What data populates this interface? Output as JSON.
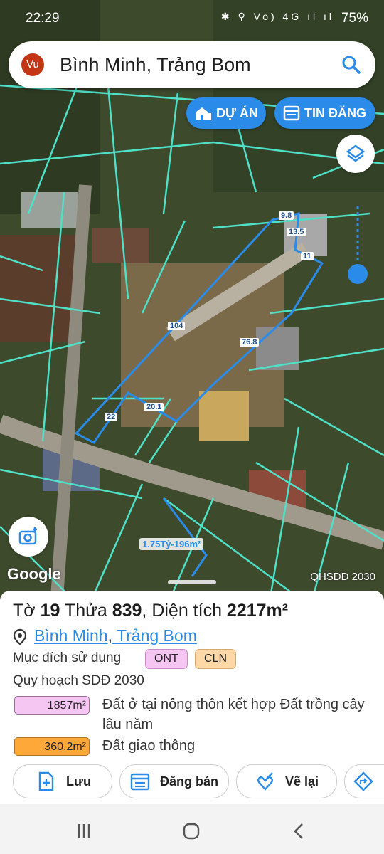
{
  "status": {
    "time": "22:29",
    "icons": "✱ ⚲ Vo) 4G ıl ıl",
    "battery": "75%"
  },
  "search": {
    "avatar": "Vu",
    "query": "Bình Minh, Trảng Bom"
  },
  "map_buttons": {
    "project": "DỰ ÁN",
    "listings": "TIN ĐĂNG"
  },
  "parcel_edges": [
    "9.8",
    "13.5",
    "11",
    "104",
    "76.8",
    "20.1",
    "22"
  ],
  "listing_label": "1.75Tỷ-196m²",
  "map_footer": {
    "brand": "Google",
    "layer": "QHSDĐ 2030"
  },
  "parcel": {
    "sheet_prefix": "Tờ ",
    "sheet_no": "19",
    "plot_prefix": " Thửa ",
    "plot_no": "839",
    "area_prefix": ", Diện tích ",
    "area": "2217m²",
    "ward": "Bình Minh",
    "sep": ", ",
    "district": "Trảng Bom",
    "purpose_label": "Mục đích sử dụng",
    "purpose_tags": [
      "ONT",
      "CLN"
    ],
    "plan_label": "Quy hoạch SDĐ 2030",
    "zones": [
      {
        "area": "1857m²",
        "desc": "Đất ở tại nông thôn kết hợp Đất trồng cây lâu năm",
        "color": "#f5c6f2"
      },
      {
        "area": "360.2m²",
        "desc": "Đất giao thông",
        "color": "#ffa83a"
      }
    ]
  },
  "actions": {
    "save": "Lưu",
    "sell": "Đăng bán",
    "redraw": "Vẽ lại"
  },
  "colors": {
    "accent": "#2a8be8",
    "parcel_line": "#4fe0c8"
  }
}
